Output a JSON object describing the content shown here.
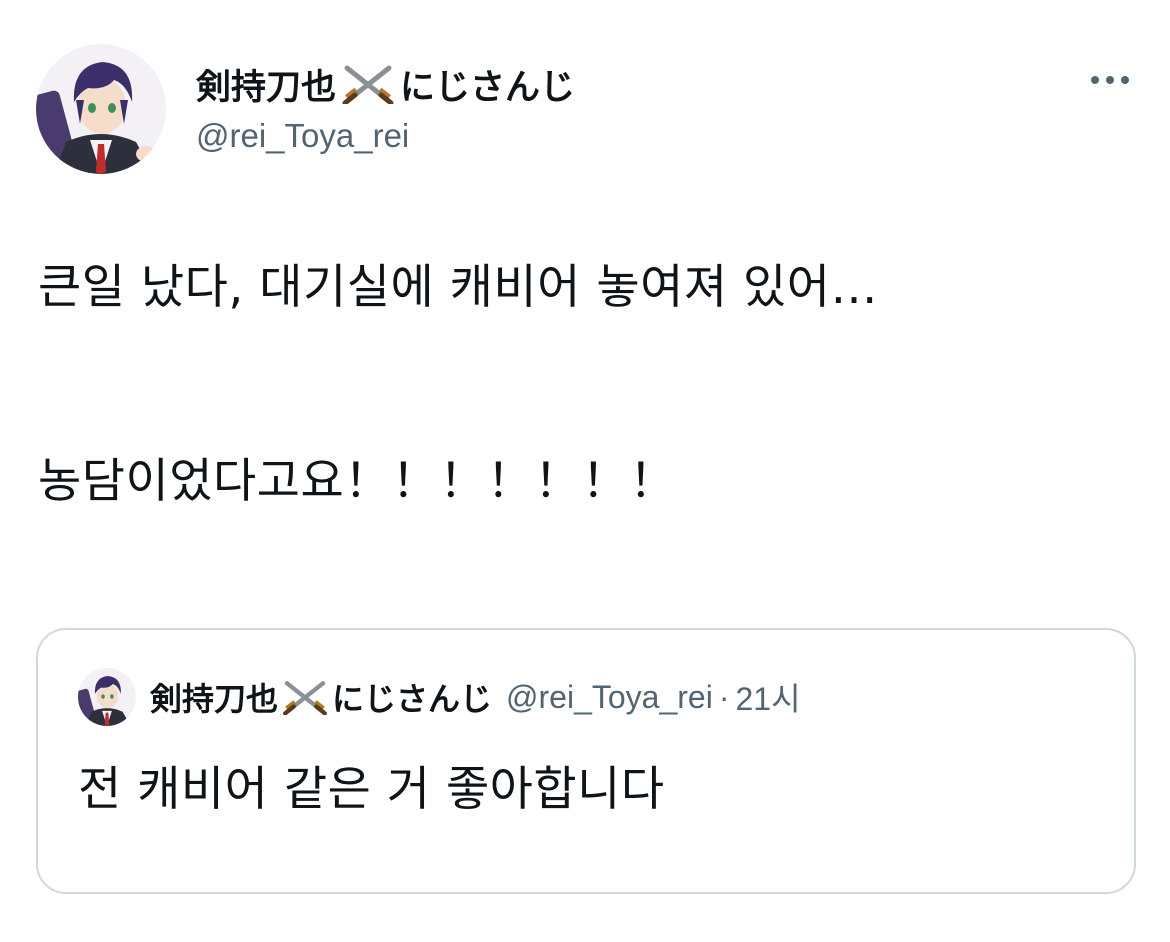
{
  "author": {
    "display_name": "剣持刀也",
    "display_name_suffix": "にじさんじ",
    "name_emoji": "crossed-swords-icon",
    "handle": "@rei_Toya_rei"
  },
  "tweet": {
    "lines": [
      "큰일 났다, 대기실에 캐비어 놓여져 있어…",
      "농담이었다고요！！！！！！！"
    ]
  },
  "quoted_tweet": {
    "display_name": "剣持刀也",
    "display_name_suffix": "にじさんじ",
    "name_emoji": "crossed-swords-icon",
    "handle": "@rei_Toya_rei",
    "separator": "·",
    "time": "21시",
    "text": "전 캐비어 같은 거 좋아합니다"
  },
  "colors": {
    "text": "#0f1419",
    "secondary": "#536471",
    "border": "#cfd9de"
  }
}
